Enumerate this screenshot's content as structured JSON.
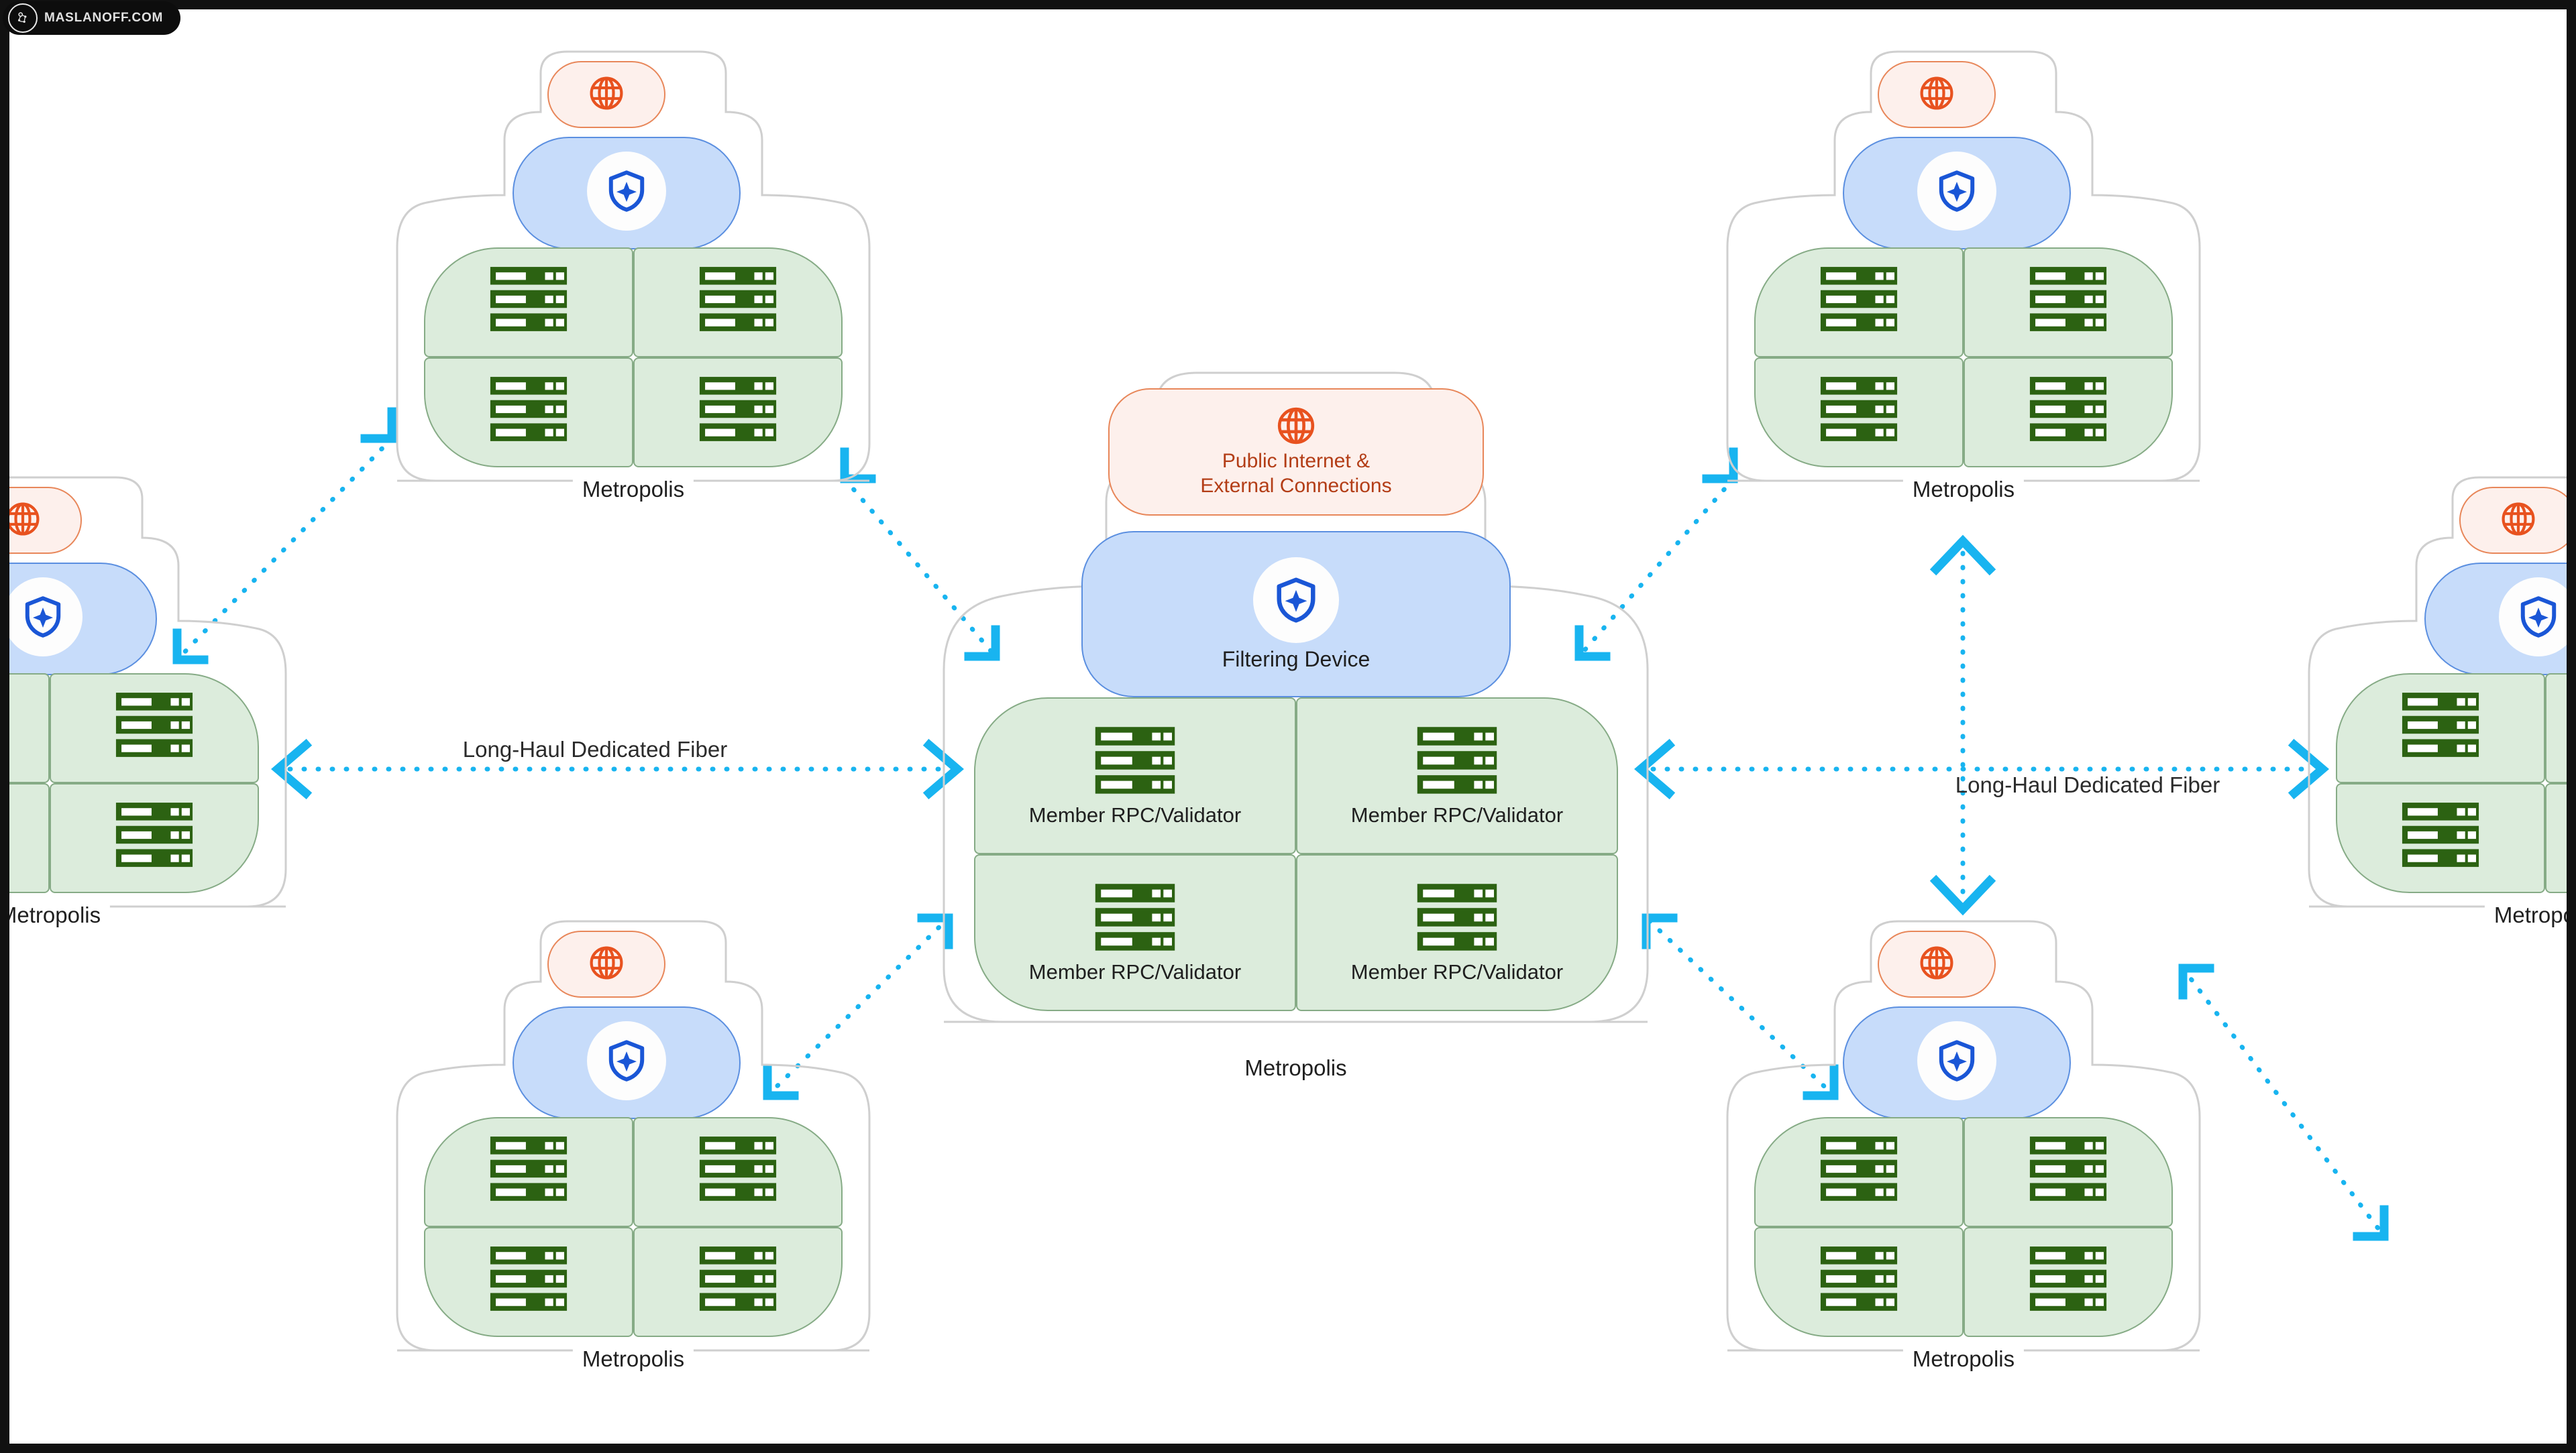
{
  "watermark": {
    "label": "MASLANOFF.COM",
    "emblem_icon": "brain-network-emblem-icon",
    "background": "#0d0d0d",
    "text_color": "#f2f2f2"
  },
  "colors": {
    "canvas": "#ffffff",
    "frame": "#111111",
    "globe_fill": "#fdf0ec",
    "globe_stroke": "#e8875a",
    "globe_icon": "#e8521f",
    "globe_text": "#b33d16",
    "shield_fill": "#c7dcfa",
    "shield_stroke": "#5b8fe0",
    "shield_icon": "#1a56d6",
    "shield_disc": "#fdfdfd",
    "server_fill": "#dcecdc",
    "server_stroke": "#86ab86",
    "server_icon": "#2c6212",
    "cloud_stroke": "#cfcfcf",
    "link": "#18b4f0",
    "label_text": "#1f1f1f"
  },
  "icons": {
    "globe": "globe-icon",
    "shield": "shield-sparkle-icon",
    "server": "server-rack-icon"
  },
  "node_labels": {
    "public_internet": "Public Internet &\nExternal Connections",
    "filtering_device": "Filtering Device",
    "member_rpc_validator": "Member RPC/Validator",
    "empty": ""
  },
  "cluster_label": "Metropolis",
  "edge_label": "Long-Haul Dedicated Fiber",
  "clusters": [
    {
      "id": "center",
      "label": "Metropolis",
      "labeled": true,
      "globe_label": "Public Internet &\nExternal Connections",
      "shield_label": "Filtering Device",
      "servers": [
        "Member RPC/Validator",
        "Member RPC/Validator",
        "Member RPC/Validator",
        "Member RPC/Validator"
      ]
    },
    {
      "id": "top-left",
      "label": "Metropolis",
      "labeled": false,
      "globe_label": "",
      "shield_label": "",
      "servers": [
        "",
        "",
        "",
        ""
      ]
    },
    {
      "id": "top-right",
      "label": "Metropolis",
      "labeled": false,
      "globe_label": "",
      "shield_label": "",
      "servers": [
        "",
        "",
        "",
        ""
      ]
    },
    {
      "id": "bottom-left",
      "label": "Metropolis",
      "labeled": false,
      "globe_label": "",
      "shield_label": "",
      "servers": [
        "",
        "",
        "",
        ""
      ]
    },
    {
      "id": "bottom-right",
      "label": "Metropolis",
      "labeled": false,
      "globe_label": "",
      "shield_label": "",
      "servers": [
        "",
        "",
        "",
        ""
      ]
    },
    {
      "id": "far-left",
      "label": "Metropolis",
      "labeled": false,
      "globe_label": "",
      "shield_label": "",
      "servers": [
        "",
        "",
        "",
        ""
      ]
    },
    {
      "id": "far-right",
      "label": "Metropolis",
      "labeled": false,
      "globe_label": "",
      "shield_label": "",
      "servers": [
        "",
        "",
        "",
        ""
      ]
    }
  ],
  "edges": [
    {
      "id": "left-fiber",
      "label": "Long-Haul Dedicated Fiber",
      "style": "dotted",
      "arrows": "both",
      "orientation": "horizontal"
    },
    {
      "id": "right-fiber",
      "label": "Long-Haul Dedicated Fiber",
      "style": "dotted",
      "arrows": "both",
      "orientation": "horizontal"
    },
    {
      "id": "topleft-center",
      "label": "",
      "style": "dotted",
      "arrows": "both",
      "orientation": "diagonal"
    },
    {
      "id": "topright-center",
      "label": "",
      "style": "dotted",
      "arrows": "both",
      "orientation": "diagonal"
    },
    {
      "id": "bottomleft-center",
      "label": "",
      "style": "dotted",
      "arrows": "both",
      "orientation": "diagonal"
    },
    {
      "id": "bottomright-center",
      "label": "",
      "style": "dotted",
      "arrows": "both",
      "orientation": "diagonal"
    },
    {
      "id": "topleft-farleft",
      "label": "",
      "style": "dotted",
      "arrows": "both",
      "orientation": "diagonal"
    },
    {
      "id": "topright-bottomright-vertical",
      "label": "",
      "style": "dotted",
      "arrows": "both",
      "orientation": "vertical"
    },
    {
      "id": "bottomright-farright",
      "label": "",
      "style": "dotted",
      "arrows": "both",
      "orientation": "diagonal"
    }
  ]
}
